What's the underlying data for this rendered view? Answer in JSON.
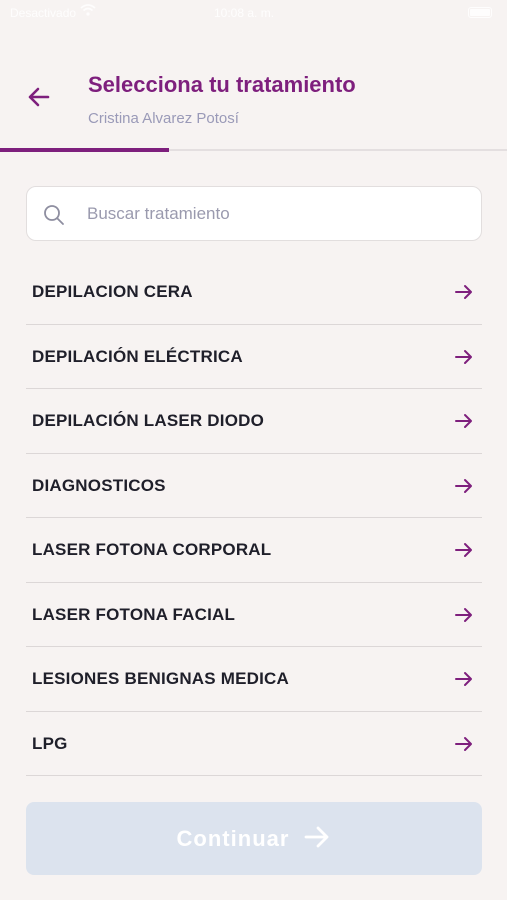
{
  "status_bar": {
    "carrier": "Desactivado",
    "time": "10:08 a. m."
  },
  "header": {
    "title": "Selecciona tu tratamiento",
    "subtitle": "Cristina Alvarez Potosí",
    "back_icon": "arrow-left-icon"
  },
  "progress": {
    "fraction": 0.333
  },
  "search": {
    "placeholder": "Buscar tratamiento",
    "value": "",
    "icon": "search-icon"
  },
  "treatments": [
    {
      "label": "DEPILACION CERA"
    },
    {
      "label": "DEPILACIÓN ELÉCTRICA"
    },
    {
      "label": "DEPILACIÓN LASER DIODO"
    },
    {
      "label": "DIAGNOSTICOS"
    },
    {
      "label": "LASER FOTONA CORPORAL"
    },
    {
      "label": "LASER FOTONA FACIAL"
    },
    {
      "label": "LESIONES BENIGNAS MEDICA"
    },
    {
      "label": "LPG"
    }
  ],
  "continue_button": {
    "label": "Continuar",
    "icon": "arrow-right-icon",
    "disabled": true
  },
  "colors": {
    "accent": "#7e1f7d",
    "background": "#f7f3f2",
    "subtitle": "#9a9ab8",
    "button_disabled": "#dce3ee"
  }
}
